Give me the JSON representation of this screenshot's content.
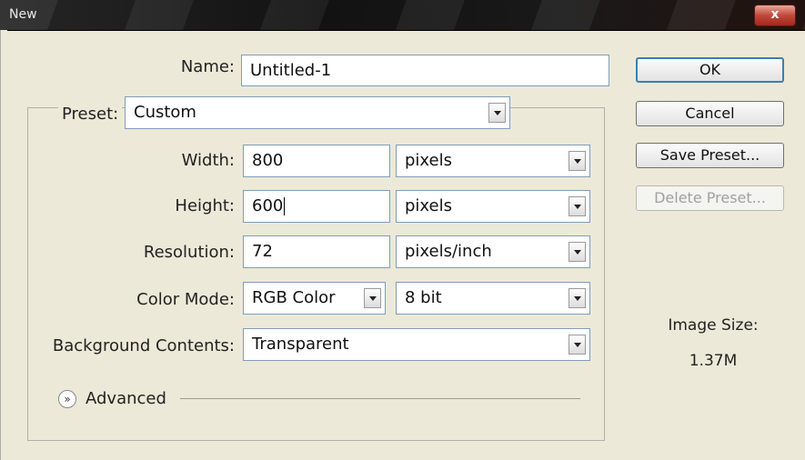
{
  "window": {
    "title": "New",
    "close_label": "x"
  },
  "form": {
    "name_label": "Name:",
    "name_value": "Untitled-1",
    "preset_label": "Preset:",
    "preset_value": "Custom",
    "width_label": "Width:",
    "width_value": "800",
    "width_unit": "pixels",
    "height_label": "Height:",
    "height_value": "600",
    "height_unit": "pixels",
    "resolution_label": "Resolution:",
    "resolution_value": "72",
    "resolution_unit": "pixels/inch",
    "color_mode_label": "Color Mode:",
    "color_mode_value": "RGB Color",
    "bit_depth_value": "8 bit",
    "background_label": "Background Contents:",
    "background_value": "Transparent",
    "advanced_label": "Advanced"
  },
  "buttons": {
    "ok": "OK",
    "cancel": "Cancel",
    "save_preset": "Save Preset...",
    "delete_preset": "Delete Preset..."
  },
  "image_size": {
    "label": "Image Size:",
    "value": "1.37M"
  },
  "icons": {
    "close": "close-icon",
    "dropdown": "chevron-down-icon",
    "advanced": "double-chevron-down-icon"
  }
}
